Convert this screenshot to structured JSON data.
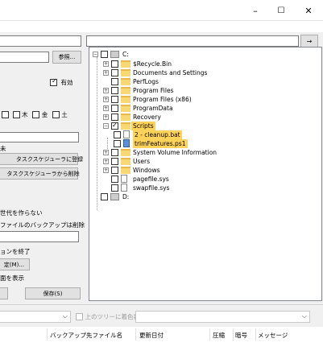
{
  "window": {
    "min_icon": "–",
    "max_icon": "☐",
    "close_icon": "✕"
  },
  "top": {
    "arrow_label": "→"
  },
  "left": {
    "browse_button": "参照...",
    "enabled_label": "有効",
    "weekday_thu": "木",
    "weekday_fri": "金",
    "weekday_sat": "土",
    "partial_text_1": "未",
    "register_task_button": "タスクスケジューラに登録",
    "delete_task_button": "タスクスケジューラから削除",
    "text_gen": "世代を作らない",
    "text_delete_backup": "ファイルのバックアップは削除",
    "text_terminate": "ョンを終了",
    "settings_button": "定(M)...",
    "text_display": "面を表示",
    "save_button": "保存(S)"
  },
  "tree": {
    "root_label": "C:",
    "items": [
      {
        "label": "$Recycle.Bin"
      },
      {
        "label": "Documents and Settings"
      },
      {
        "label": "PerfLogs"
      },
      {
        "label": "Program Files"
      },
      {
        "label": "Program Files (x86)"
      },
      {
        "label": "ProgramData"
      },
      {
        "label": "Recovery"
      },
      {
        "label": "Scripts"
      },
      {
        "label": "2 - cleanup.bat"
      },
      {
        "label": "trimFeatures.ps1"
      },
      {
        "label": "System Volume Information"
      },
      {
        "label": "Users"
      },
      {
        "label": "Windows"
      },
      {
        "label": "pagefile.sys"
      },
      {
        "label": "swapfile.sys"
      }
    ],
    "drive_d_label": "D:"
  },
  "bottom": {
    "color_tree_label": "上のツリーに着色表示",
    "columns": [
      "バックアップ先ファイル名",
      "更新日付",
      "圧縮",
      "暗号",
      "メッセージ"
    ]
  }
}
